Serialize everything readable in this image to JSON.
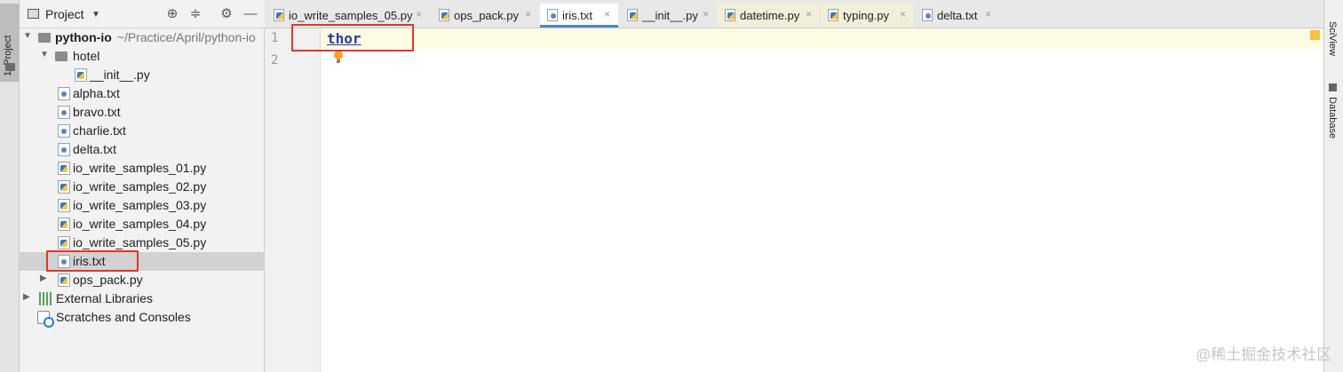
{
  "left_strip": {
    "tab_label": "1: Project"
  },
  "project_panel": {
    "title": "Project",
    "header_icons": [
      "locate-icon",
      "collapse-icon",
      "gear-icon",
      "minimize-icon"
    ],
    "tree": [
      {
        "label": "python-io",
        "path": "~/Practice/April/python-io",
        "kind": "root"
      },
      {
        "label": "hotel",
        "kind": "folder"
      },
      {
        "label": "__init__.py",
        "kind": "py"
      },
      {
        "label": "alpha.txt",
        "kind": "file"
      },
      {
        "label": "bravo.txt",
        "kind": "file"
      },
      {
        "label": "charlie.txt",
        "kind": "file"
      },
      {
        "label": "delta.txt",
        "kind": "file"
      },
      {
        "label": "io_write_samples_01.py",
        "kind": "py"
      },
      {
        "label": "io_write_samples_02.py",
        "kind": "py"
      },
      {
        "label": "io_write_samples_03.py",
        "kind": "py"
      },
      {
        "label": "io_write_samples_04.py",
        "kind": "py"
      },
      {
        "label": "io_write_samples_05.py",
        "kind": "py"
      },
      {
        "label": "iris.txt",
        "kind": "file",
        "selected": true
      },
      {
        "label": "ops_pack.py",
        "kind": "py"
      },
      {
        "label": "External Libraries",
        "kind": "lib"
      },
      {
        "label": "Scratches and Consoles",
        "kind": "scratch"
      }
    ]
  },
  "tabs": [
    {
      "label": "io_write_samples_05.py"
    },
    {
      "label": "ops_pack.py"
    },
    {
      "label": "iris.txt",
      "active": true
    },
    {
      "label": "__init__.py"
    },
    {
      "label": "datetime.py"
    },
    {
      "label": "typing.py"
    },
    {
      "label": "delta.txt"
    }
  ],
  "editor": {
    "line_numbers": [
      "1",
      "2"
    ],
    "code_line_1": "thor"
  },
  "right_strip": {
    "tabs": [
      "SciView",
      "Database"
    ]
  },
  "watermark": "@稀土掘金技术社区",
  "colors": {
    "highlight_box": "#e0362b",
    "active_tab_underline": "#4a88c7",
    "caret_line": "#fdfbe4"
  }
}
